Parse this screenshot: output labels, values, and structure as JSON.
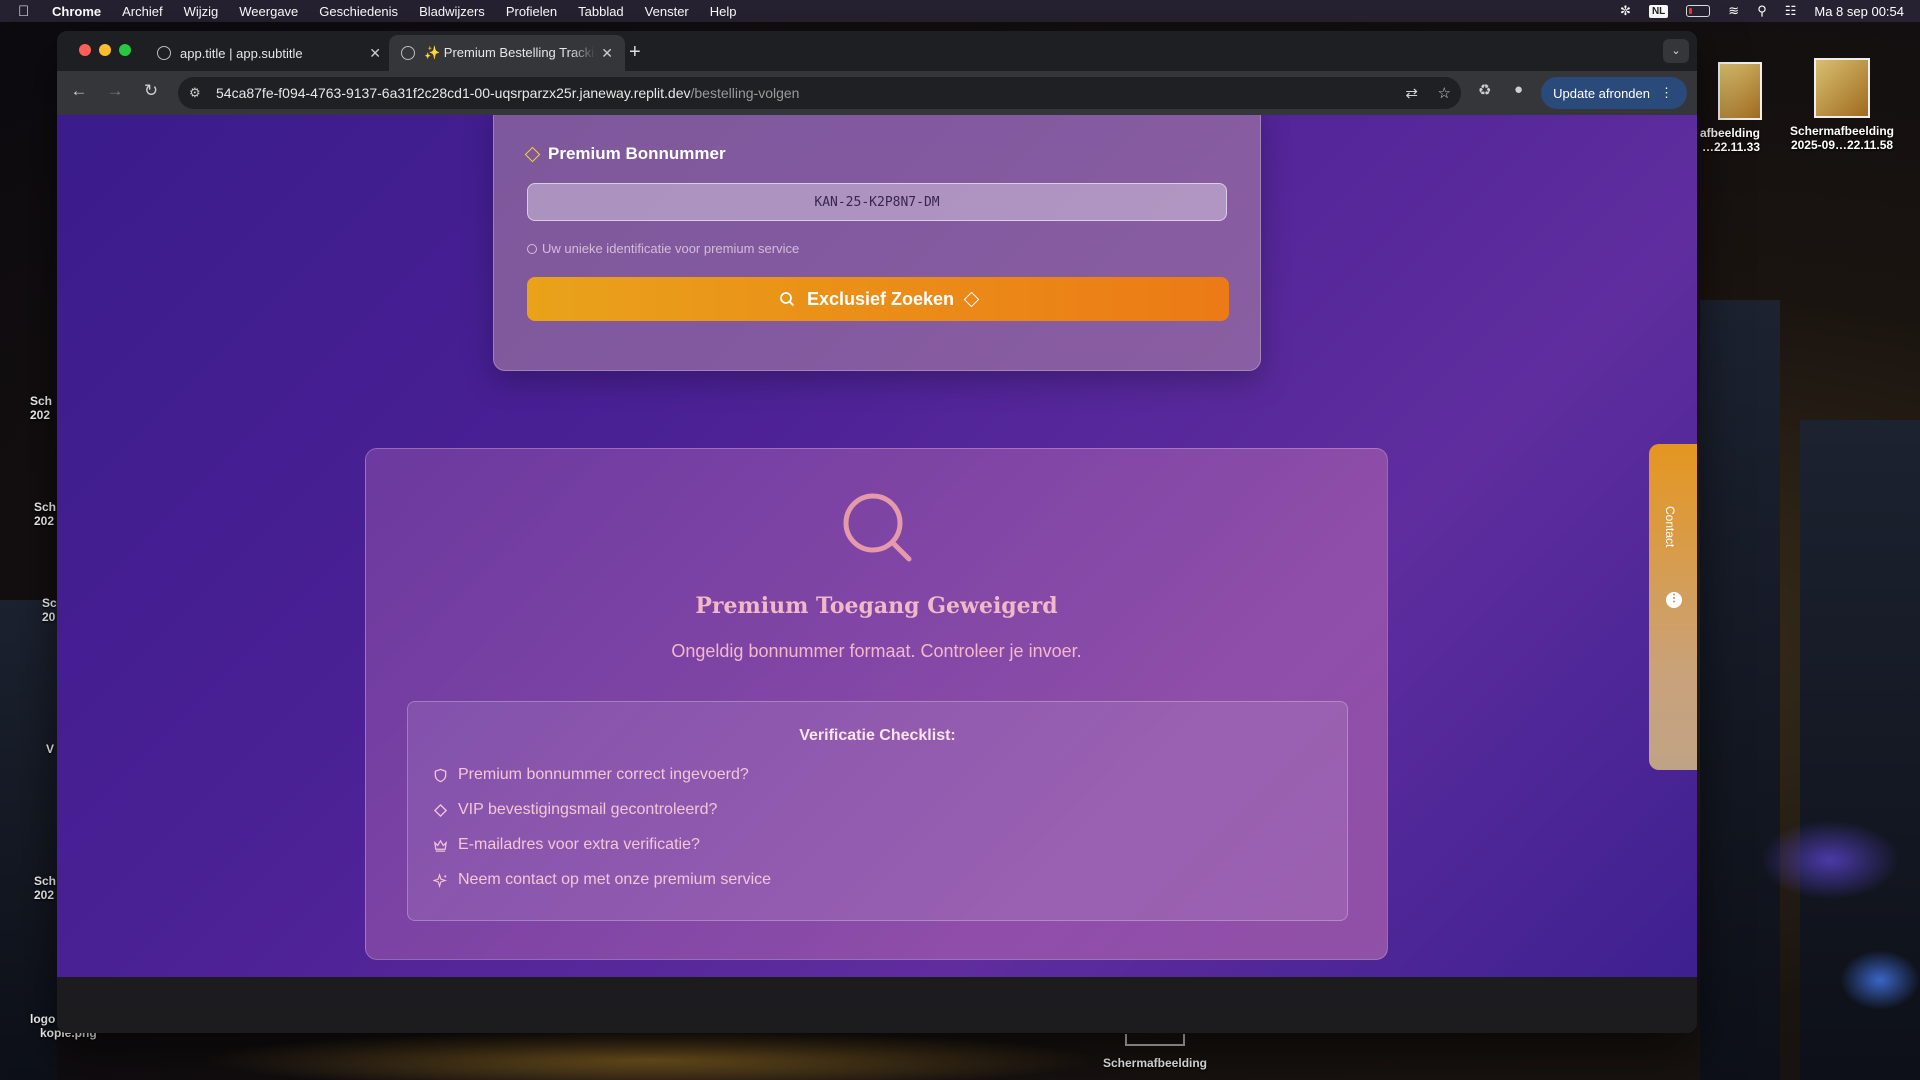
{
  "menubar": {
    "app": "Chrome",
    "items": [
      "Archief",
      "Wijzig",
      "Weergave",
      "Geschiedenis",
      "Bladwijzers",
      "Profielen",
      "Tabblad",
      "Venster",
      "Help"
    ],
    "language": "NL",
    "datetime": "Ma 8 sep  00:54"
  },
  "desktop": {
    "icon_right_1": "afbeelding\n…22.11.33",
    "icon_right_2_line1": "Schermafbeelding",
    "icon_right_2_line2": "2025-09…22.11.58",
    "icon_bottom": "Schermafbeelding",
    "icon_left_logo_1": "logo",
    "icon_left_logo_2": "kopie.png",
    "left_fragments": [
      "Sch\n202",
      "Sch\n202",
      "Sc\n20",
      "V",
      "Sch\n202"
    ]
  },
  "browser": {
    "tabs": [
      {
        "title": "app.title | app.subtitle",
        "active": false
      },
      {
        "title": "✨ Premium Bestelling Tracking",
        "active": true
      }
    ],
    "url_main": "54ca87fe-f094-4763-9137-6a31f2c28cd1-00-uqsrparzx25r.janeway.replit.dev",
    "url_path": "/bestelling-volgen",
    "update_label": "Update afronden"
  },
  "search_form": {
    "label": "Premium Bonnummer",
    "input_value": "KAN-25-K2P8N7-DM",
    "hint": "Uw unieke identificatie voor premium service",
    "button_label": "Exclusief Zoeken"
  },
  "result": {
    "title": "Premium Toegang Geweigerd",
    "message": "Ongeldig bonnummer formaat. Controleer je invoer.",
    "checklist_title": "Verificatie Checklist:",
    "checklist": [
      {
        "icon": "shield-icon",
        "text": "Premium bonnummer correct ingevoerd?"
      },
      {
        "icon": "diamond-icon",
        "text": "VIP bevestigingsmail gecontroleerd?"
      },
      {
        "icon": "crown-icon",
        "text": "E-mailadres voor extra verificatie?"
      },
      {
        "icon": "sparkles-icon",
        "text": "Neem contact op met onze premium service"
      }
    ]
  },
  "contact_tab": {
    "label": "Contact"
  },
  "colors": {
    "accent_orange": "#ec7a16",
    "accent_yellow": "#ffd21e",
    "bg_purple": "#4a2095"
  }
}
